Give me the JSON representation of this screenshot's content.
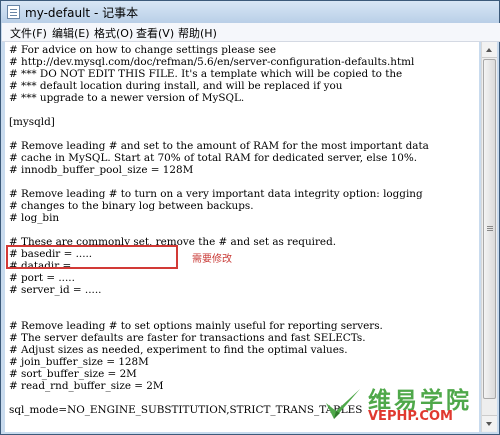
{
  "window": {
    "title": "my-default - 记事本"
  },
  "menu": [
    {
      "label": "文件(F)"
    },
    {
      "label": "编辑(E)"
    },
    {
      "label": "格式(O)"
    },
    {
      "label": "查看(V)"
    },
    {
      "label": "帮助(H)"
    }
  ],
  "lines": [
    "# For advice on how to change settings please see",
    "# http://dev.mysql.com/doc/refman/5.6/en/server-configuration-defaults.html",
    "# *** DO NOT EDIT THIS FILE. It's a template which will be copied to the",
    "# *** default location during install, and will be replaced if you",
    "# *** upgrade to a newer version of MySQL.",
    "",
    "[mysqld]",
    "",
    "# Remove leading # and set to the amount of RAM for the most important data",
    "# cache in MySQL. Start at 70% of total RAM for dedicated server, else 10%.",
    "# innodb_buffer_pool_size = 128M",
    "",
    "# Remove leading # to turn on a very important data integrity option: logging",
    "# changes to the binary log between backups.",
    "# log_bin",
    "",
    "# These are commonly set, remove the # and set as required.",
    "# basedir = .....",
    "# datadir = .....",
    "# port = .....",
    "# server_id = .....",
    "",
    "",
    "# Remove leading # to set options mainly useful for reporting servers.",
    "# The server defaults are faster for transactions and fast SELECTs.",
    "# Adjust sizes as needed, experiment to find the optimal values.",
    "# join_buffer_size = 128M",
    "# sort_buffer_size = 2M",
    "# read_rnd_buffer_size = 2M",
    "",
    "sql_mode=NO_ENGINE_SUBSTITUTION,STRICT_TRANS_TABLES"
  ],
  "annotation": {
    "text": "需要修改",
    "color": "#d23a36"
  },
  "watermark": {
    "title": "维易学院",
    "url": "VEPHP.COM",
    "title_color": "#4fa84a",
    "url_color": "#e0392f"
  },
  "icons": {
    "app": "notepad-icon",
    "scroll_up": "scroll-up-arrow-icon",
    "scroll_down": "scroll-down-arrow-icon"
  }
}
